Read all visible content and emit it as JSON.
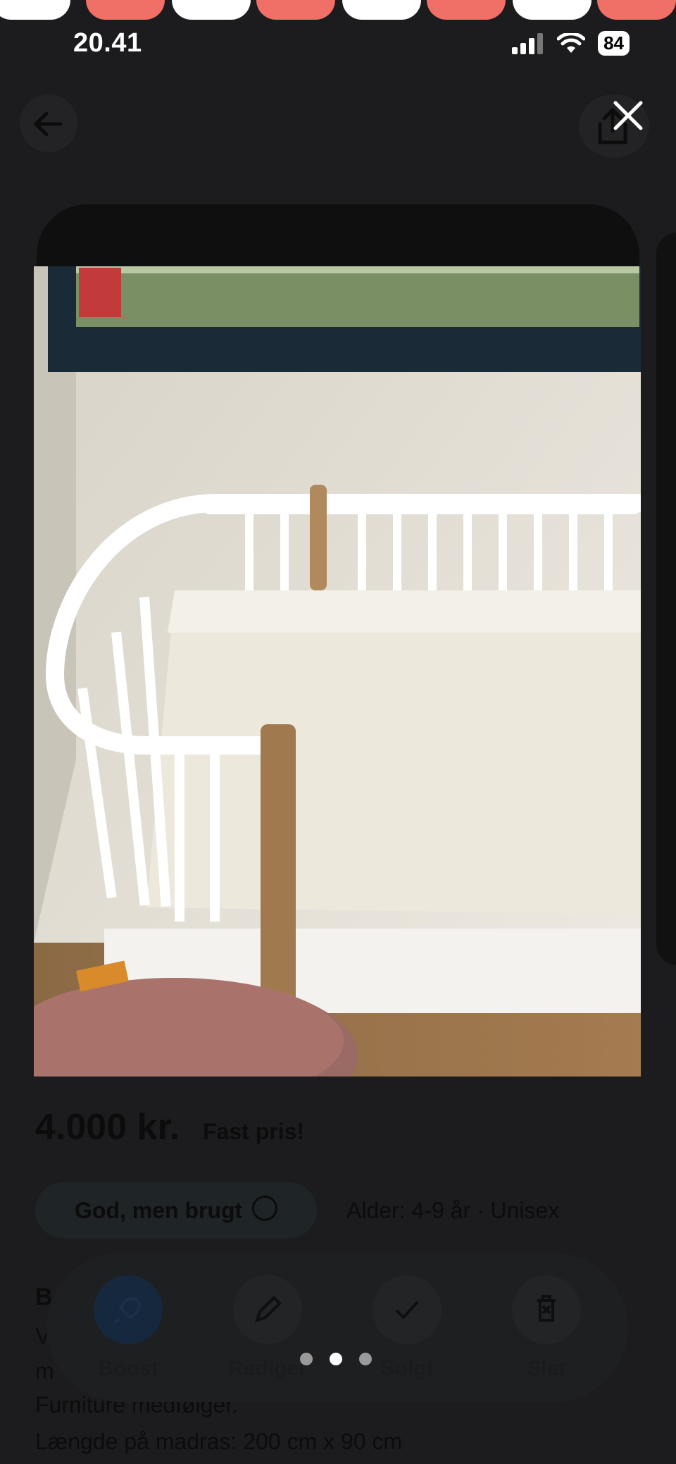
{
  "status_bar": {
    "time": "20.41",
    "battery": "84"
  },
  "top_dots": [
    "#ffffff",
    "#f07067",
    "#ffffff",
    "#f07067",
    "#ffffff",
    "#f07067",
    "#ffffff",
    "#f07067"
  ],
  "header": {
    "back_icon": "arrow-left-icon",
    "share_icon": "share-icon",
    "close_icon": "close-icon"
  },
  "gallery": {
    "pages": 3,
    "active_page": 2
  },
  "listing": {
    "price": "4.000 kr.",
    "price_note": "Fast pris!",
    "condition": "God, men brugt",
    "age_gender": "Alder: 4-9 år · Unisex",
    "desc_initial": "B",
    "desc_lines": [
      "V",
      "m",
      "Furniture medfølger.",
      "Længde på madras: 200 cm x 90 cm"
    ]
  },
  "actions": [
    {
      "label": "Boost",
      "icon": "rocket-icon"
    },
    {
      "label": "Rediger",
      "icon": "pencil-icon"
    },
    {
      "label": "Solgt",
      "icon": "check-icon"
    },
    {
      "label": "Slet",
      "icon": "trash-icon"
    }
  ],
  "colors": {
    "background": "#1c1c1e",
    "accent_coral": "#f07067",
    "boost_blue": "#16283e"
  }
}
